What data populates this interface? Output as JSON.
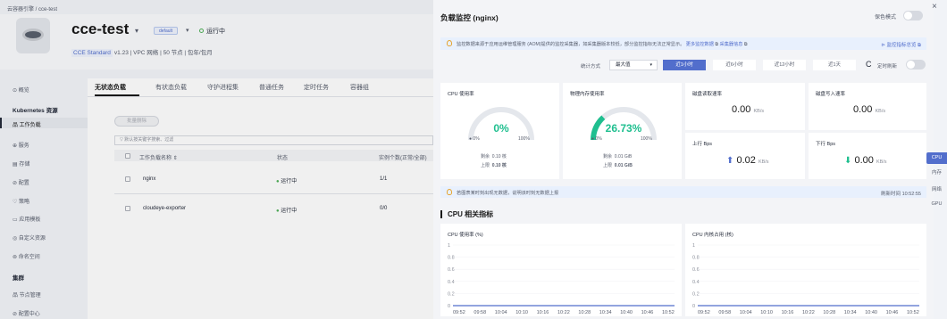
{
  "breadcrumb": "云容器引擎 / cce-test",
  "cluster": {
    "name": "cce-test",
    "namespace_badge": "default",
    "status": "运行中",
    "edition": "CCE Standard",
    "info": "v1.23 | VPC 网络 | 50 节点 | 包年/包月"
  },
  "nav": {
    "overview": "概览",
    "k8s_section": "Kubernetes 资源",
    "workloads": "工作负载",
    "services": "服务",
    "storage": "存储",
    "config": "配置",
    "policy": "策略",
    "templates": "应用模板",
    "crd": "自定义资源",
    "namespaces": "命名空间",
    "cluster_section": "集群",
    "nodes": "节点管理",
    "config_center": "配置中心"
  },
  "tabs": [
    "无状态负载",
    "有状态负载",
    "守护进程集",
    "普通任务",
    "定时任务",
    "容器组"
  ],
  "batch_delete": "批量删除",
  "search_placeholder": "默认按关键字搜索、过滤",
  "table": {
    "headers": [
      "工作负载名称 ⇕",
      "状态",
      "实例个数(正常/全部)"
    ],
    "rows": [
      {
        "name": "nginx",
        "status": "运行中",
        "count": "1/1"
      },
      {
        "name": "cloudeye-exporter",
        "status": "运行中",
        "count": "0/0"
      }
    ]
  },
  "panel": {
    "title": "负载监控 (nginx)",
    "protect_mode": "保色模式",
    "banner_text": "监控数据来源于应用运维管理服务 (AOM)提供的监控采集器，如采集器版本较低，部分监控指标无法正常显示。",
    "banner_link1": "更多监控数据",
    "banner_link2": "采集器信息",
    "aom_link": "监控指标总览",
    "stat_label": "统计方式",
    "stat_value": "最大值",
    "ranges": [
      "近1小时",
      "近6小时",
      "近12小时",
      "近1天"
    ],
    "refresh_label": "定时刷新",
    "cpu_card": {
      "title": "CPU 使用率",
      "value": "0%",
      "min": "0%",
      "max": "100%",
      "remain_label": "剩余",
      "remain": "0.10 核",
      "limit_label": "上限",
      "limit": "0.10 核",
      "fraction": 0.0
    },
    "mem_card": {
      "title": "物理内存使用率",
      "value": "26.73%",
      "min": "0%",
      "max": "100%",
      "remain_label": "剩余",
      "remain": "0.01 GiB",
      "limit_label": "上限",
      "limit": "0.01 GiB",
      "fraction": 0.2673
    },
    "disk_read": {
      "title": "磁盘读取速率",
      "value": "0.00",
      "unit": "KB/s"
    },
    "disk_write": {
      "title": "磁盘写入速率",
      "value": "0.00",
      "unit": "KB/s"
    },
    "up": {
      "title": "上行 Bps",
      "value": "0.02",
      "unit": "KB/s"
    },
    "down": {
      "title": "下行 Bps",
      "value": "0.00",
      "unit": "KB/s"
    },
    "tip": "若图表某时刻出现无数据，说明该时刻无数据上报",
    "refresh_time": "刷新时间 10:52:55",
    "section_title": "CPU 相关指标",
    "side_tabs": [
      "CPU",
      "内存",
      "网络",
      "GPU"
    ],
    "colors": {
      "accent": "#526ecc",
      "green": "#1fbf8f",
      "grey_track": "#e4e7ec"
    }
  },
  "chart_data": [
    {
      "type": "line",
      "title": "CPU 使用率 (%)",
      "x": [
        "09:52",
        "09:58",
        "10:04",
        "10:10",
        "10:16",
        "10:22",
        "10:28",
        "10:34",
        "10:40",
        "10:46",
        "10:52"
      ],
      "yticks": [
        "1",
        "0.8",
        "0.6",
        "0.4",
        "0.2",
        "0"
      ],
      "ylim": [
        0,
        1
      ],
      "series": [
        {
          "values": [
            0,
            0,
            0,
            0,
            0,
            0,
            0,
            0,
            0,
            0,
            0
          ]
        }
      ]
    },
    {
      "type": "line",
      "title": "CPU 内核占用 (核)",
      "x": [
        "09:52",
        "09:58",
        "10:04",
        "10:10",
        "10:16",
        "10:22",
        "10:28",
        "10:34",
        "10:40",
        "10:46",
        "10:52"
      ],
      "yticks": [
        "1",
        "0.8",
        "0.6",
        "0.4",
        "0.2",
        "0"
      ],
      "ylim": [
        0,
        1
      ],
      "series": [
        {
          "values": [
            0,
            0,
            0,
            0,
            0,
            0,
            0,
            0,
            0,
            0,
            0
          ]
        }
      ]
    }
  ]
}
